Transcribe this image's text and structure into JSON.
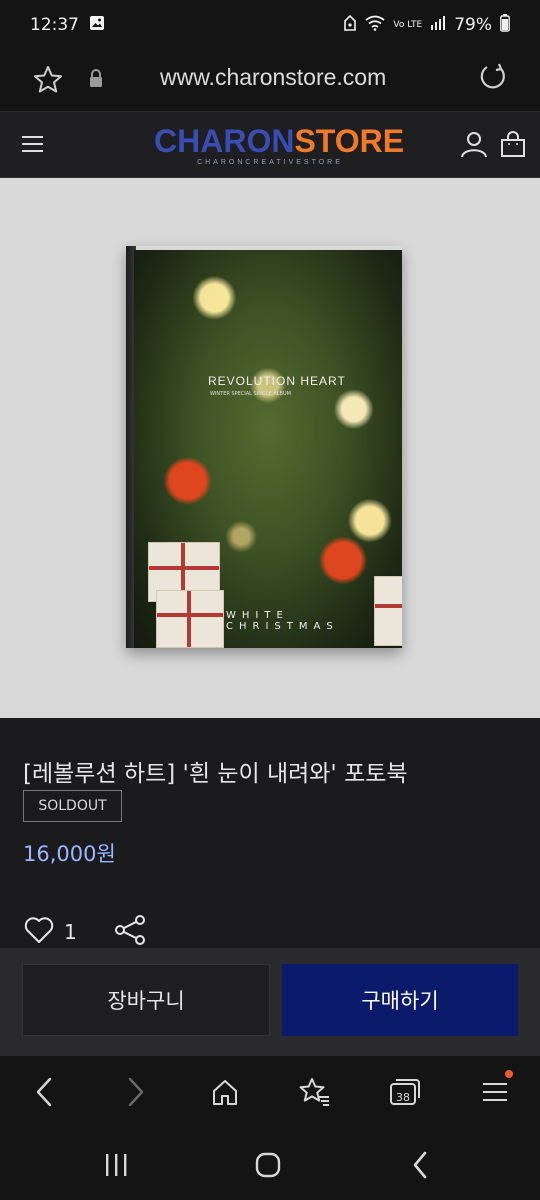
{
  "status_bar": {
    "time": "12:37",
    "network": "Vo LTE",
    "battery": "79%"
  },
  "browser": {
    "url": "www.charonstore.com",
    "tabs_count": "38"
  },
  "site": {
    "logo": {
      "part1": "CHARON",
      "part2": "STORE",
      "tagline": "CHARONCREATIVESTORE"
    }
  },
  "product": {
    "cover_title": "REVOLUTION HEART",
    "cover_subtitle": "WINTER SPECIAL SINGLE ALBUM",
    "cover_bottom_text": "WHITE CHRISTMAS",
    "title": "[레볼루션 하트] '흰 눈이 내려와' 포토북",
    "badge": "SOLDOUT",
    "price": "16,000원",
    "likes": "1"
  },
  "actions": {
    "cart_label": "장바구니",
    "buy_label": "구매하기"
  },
  "colors": {
    "logo_blue": "#3a4db3",
    "logo_orange": "#f07a2a",
    "buy_button": "#0b1a6b",
    "price": "#9cb6ff",
    "notification_dot": "#f05a28"
  },
  "icons": [
    "photo-icon",
    "alarm-icon",
    "wifi-icon",
    "signal-icon",
    "battery-icon",
    "star-icon",
    "lock-icon",
    "reload-icon",
    "menu-icon",
    "user-icon",
    "shopping-bag-icon",
    "heart-icon",
    "share-icon",
    "back-icon",
    "forward-icon",
    "home-icon",
    "bookmarks-icon",
    "tabs-icon",
    "browser-menu-icon",
    "recent-apps-icon",
    "home-circle-icon",
    "system-back-icon"
  ]
}
